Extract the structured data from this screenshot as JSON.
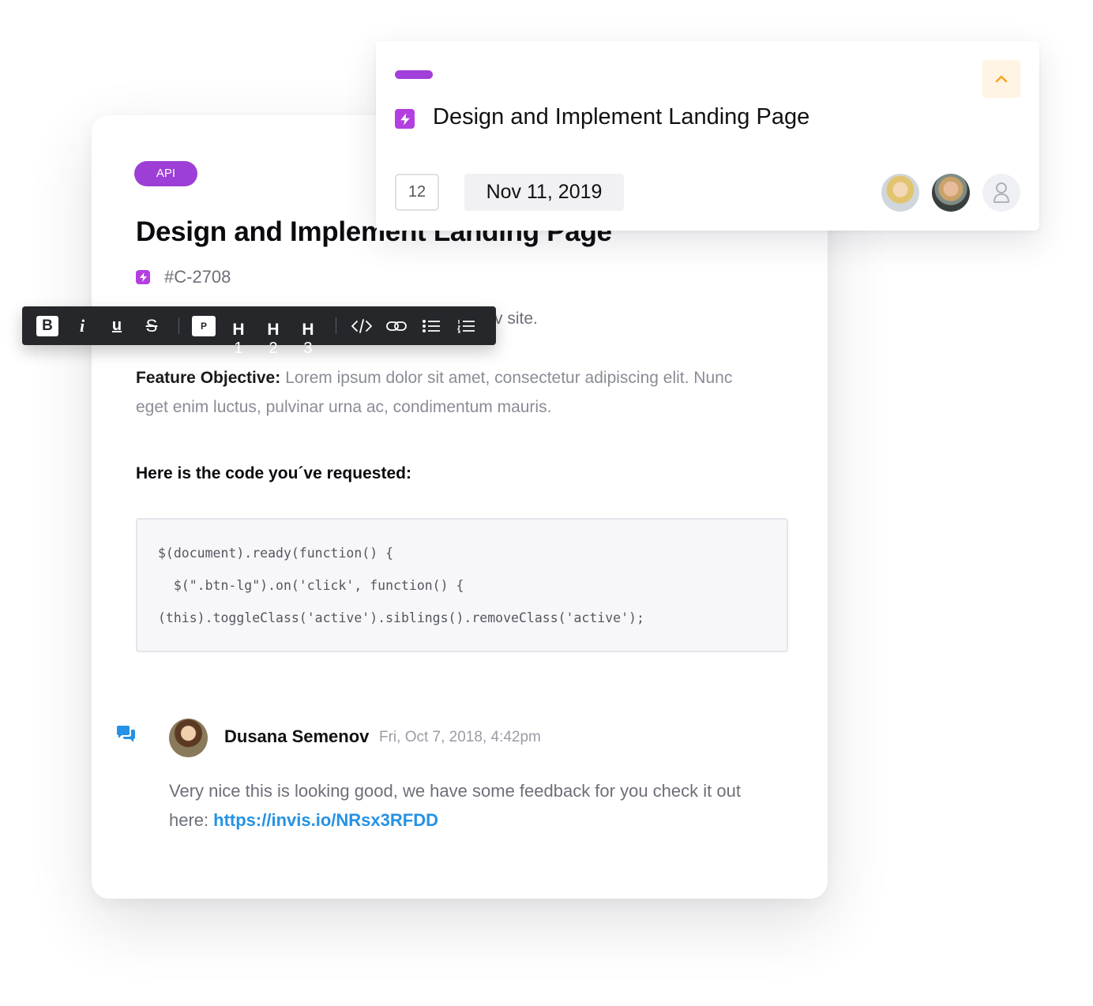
{
  "main_card": {
    "tag": "API",
    "title": "Design and Implement Landing Page",
    "ticket_id": "#C-2708",
    "partial_text": "v site.",
    "objective_label": "Feature Objective:",
    "objective_text": "Lorem ipsum dolor sit amet, consectetur adipiscing elit. Nunc eget enim luctus, pulvinar urna ac, condimentum mauris.",
    "code_heading": "Here is the code you´ve requested:",
    "code_lines": [
      "$(document).ready(function() {",
      "  $(\".btn-lg\").on('click', function() {",
      "(this).toggleClass('active').siblings().removeClass('active');"
    ]
  },
  "comment": {
    "author": "Dusana Semenov",
    "timestamp": "Fri, Oct 7, 2018, 4:42pm",
    "text": "Very nice this is looking good, we have some feedback for you  check it out here:",
    "link": "https://invis.io/NRsx3RFDD"
  },
  "toolbar": {
    "bold": "B",
    "italic": "i",
    "underline": "u",
    "strike": "S",
    "paragraph": "P",
    "h1": "H",
    "h1_num": "1",
    "h2": "H",
    "h2_num": "2",
    "h3": "H",
    "h3_num": "3",
    "icons": [
      "bold-icon",
      "italic-icon",
      "underline-icon",
      "strikethrough-icon",
      "paragraph-icon",
      "heading-1-icon",
      "heading-2-icon",
      "heading-3-icon",
      "code-icon",
      "link-icon",
      "bullet-list-icon",
      "numbered-list-icon"
    ]
  },
  "top_card": {
    "title": "Design and Implement Landing Page",
    "count": "12",
    "date": "Nov 11, 2019",
    "assignees": [
      "avatar-blonde-woman",
      "avatar-smiling-man",
      "avatar-placeholder"
    ]
  },
  "colors": {
    "accent_purple": "#9d3fd6",
    "link_blue": "#2592e5",
    "toolbar_dark": "#25272b",
    "chevron_orange": "#f5a623"
  }
}
